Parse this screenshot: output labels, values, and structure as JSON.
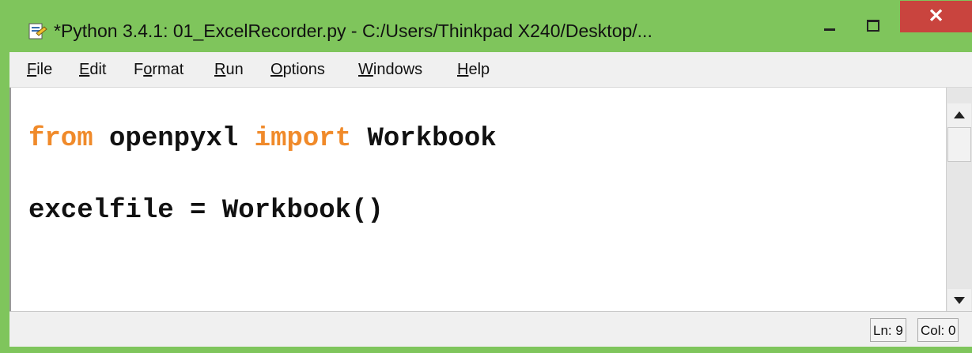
{
  "window": {
    "title": "*Python 3.4.1: 01_ExcelRecorder.py - C:/Users/Thinkpad X240/Desktop/...",
    "close_glyph": "✕",
    "accent_color": "#7fc55c",
    "close_color": "#c9443e"
  },
  "menu": {
    "items": [
      {
        "pre": "",
        "ul": "F",
        "post": "ile"
      },
      {
        "pre": "",
        "ul": "E",
        "post": "dit"
      },
      {
        "pre": "F",
        "ul": "o",
        "post": "rmat"
      },
      {
        "pre": "",
        "ul": "R",
        "post": "un"
      },
      {
        "pre": "",
        "ul": "O",
        "post": "ptions"
      },
      {
        "pre": "",
        "ul": "W",
        "post": "indows"
      },
      {
        "pre": "",
        "ul": "H",
        "post": "elp"
      }
    ]
  },
  "editor": {
    "lines": [
      {
        "kw1": "from",
        "mid": " openpyxl ",
        "kw2": "import",
        "end": " Workbook"
      },
      {
        "text": "excelfile = Workbook()"
      }
    ],
    "keyword_color": "#f08a2a"
  },
  "status": {
    "line": "Ln: 9",
    "col": "Col: 0"
  }
}
